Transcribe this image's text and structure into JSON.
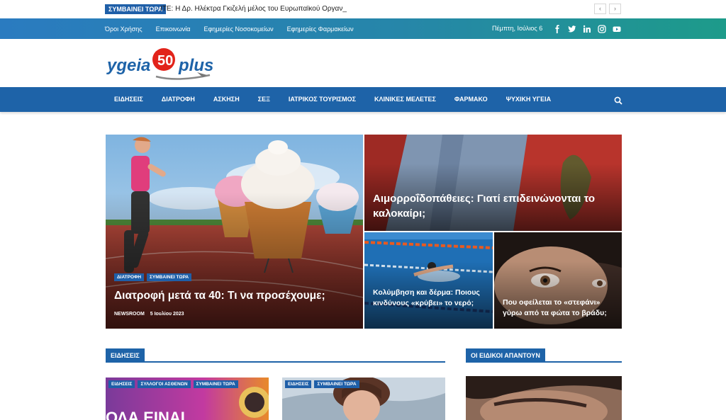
{
  "ticker": {
    "badge": "ΣΥΜΒΑΙΝΕΙ ΤΩΡΑ",
    "text": "ΙΤΕ: Η  Δρ. Ηλέκτρα Γκιζελή μέλος του Ευρωπαϊκού Οργαν_",
    "prev": "‹",
    "next": "›"
  },
  "topbar": {
    "links": [
      "Όροι Χρήσης",
      "Επικοινωνία",
      "Εφημερίες Νοσοκομείων",
      "Εφημερίες Φαρμακείων"
    ],
    "date": "Πέμπτη, Ιούλιος 6",
    "socials": [
      "f",
      "t",
      "in",
      "ig",
      "yt"
    ]
  },
  "logo": {
    "text_left": "ygeia",
    "number": "50",
    "text_right": "plus"
  },
  "nav": {
    "items": [
      "ΕΙΔΗΣΕΙΣ",
      "ΔΙΑΤΡΟΦΗ",
      "ΑΣΚΗΣΗ",
      "ΣΕΞ",
      "ΙΑΤΡΙΚΟΣ ΤΟΥΡΙΣΜΟΣ",
      "ΚΛΙΝΙΚΕΣ ΜΕΛΕΤΕΣ",
      "ΦΑΡΜΑΚΟ",
      "ΨΥΧΙΚΗ ΥΓΕΙΑ"
    ],
    "search_icon": "search-icon"
  },
  "hero": {
    "main": {
      "tags": [
        "ΔΙΑΤΡΟΦΗ",
        "ΣΥΜΒΑΙΝΕΙ ΤΩΡΑ"
      ],
      "title": "Διατροφή μετά τα 40: Τι να προσέχουμε;",
      "author": "NEWSROOM",
      "date": "5 Ιουλίου 2023"
    },
    "top": {
      "title": "Αιμορροΐδοπάθειες: Γιατί επιδεινώνονται το καλοκαίρι;"
    },
    "bottom_left": {
      "title": "Κολύμβηση και δέρμα: Ποιους κινδύνους «κρύβει» το νερό;"
    },
    "bottom_right": {
      "title": "Που οφείλεται το «στεφάνι» γύρω από τα φώτα το βράδυ;"
    }
  },
  "sections": {
    "news": "ΕΙΔΗΣΕΙΣ",
    "experts": "ΟΙ ΕΙΔΙΚΟΙ ΑΠΑΝΤΟΥΝ"
  },
  "cards": {
    "card1": {
      "tags": [
        "ΕΙΔΗΣΕΙΣ",
        "ΣΥΛΛΟΓΟΙ ΑΣΘΕΝΩΝ",
        "ΣΥΜΒΑΙΝΕΙ ΤΩΡΑ"
      ],
      "image_text": "ΟΛΑ ΕΙΝΑΙ"
    },
    "card2": {
      "tags": [
        "ΕΙΔΗΣΕΙΣ",
        "ΣΥΜΒΑΙΝΕΙ ΤΩΡΑ"
      ]
    }
  },
  "colors": {
    "brand": "#1e63a8",
    "tag": "#1f5fa8",
    "gradient_end": "#1d9b8a"
  }
}
